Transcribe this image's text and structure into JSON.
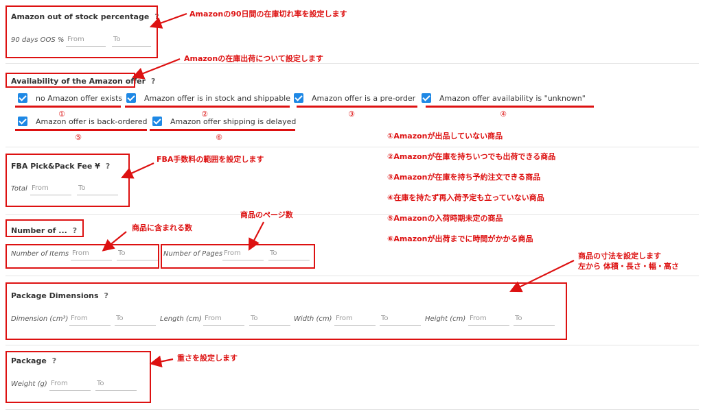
{
  "oos": {
    "title": "Amazon out of stock percentage",
    "help": "?",
    "label": "90 days OOS %",
    "from_placeholder": "From",
    "to_placeholder": "To"
  },
  "availability": {
    "title": "Availability of the Amazon offer",
    "help": "?",
    "options": [
      {
        "label": "no Amazon offer exists",
        "checked": true,
        "num": "①"
      },
      {
        "label": "Amazon offer is in stock and shippable",
        "checked": true,
        "num": "②"
      },
      {
        "label": "Amazon offer is a pre-order",
        "checked": true,
        "num": "③"
      },
      {
        "label": "Amazon offer availability is \"unknown\"",
        "checked": true,
        "num": "④"
      },
      {
        "label": "Amazon offer is back-ordered",
        "checked": true,
        "num": "⑤"
      },
      {
        "label": "Amazon offer shipping is delayed",
        "checked": true,
        "num": "⑥"
      }
    ]
  },
  "fba": {
    "title": "FBA Pick&Pack Fee ¥",
    "help": "?",
    "label": "Total",
    "from_placeholder": "From",
    "to_placeholder": "To"
  },
  "number_of": {
    "title": "Number of ...",
    "help": "?",
    "items_label": "Number of Items",
    "pages_label": "Number of Pages",
    "from_placeholder": "From",
    "to_placeholder": "To"
  },
  "dimensions": {
    "title": "Package Dimensions",
    "help": "?",
    "fields": [
      {
        "label": "Dimension (cm³)"
      },
      {
        "label": "Length (cm)"
      },
      {
        "label": "Width (cm)"
      },
      {
        "label": "Height (cm)"
      }
    ],
    "from_placeholder": "From",
    "to_placeholder": "To"
  },
  "package": {
    "title": "Package",
    "help": "?",
    "label": "Weight (g)",
    "from_placeholder": "From",
    "to_placeholder": "To"
  },
  "annotations": {
    "oos": "Amazonの90日間の在庫切れ率を設定します",
    "availability": "Amazonの在庫出荷について設定します",
    "fba": "FBA手数料の範囲を設定します",
    "items": "商品に含まれる数",
    "pages": "商品のページ数",
    "dims_line1": "商品の寸法を設定します",
    "dims_line2": "左から 体積・長さ・幅・高さ",
    "weight": "重さを設定します"
  },
  "notes": [
    "①Amazonが出品していない商品",
    "②Amazonが在庫を持ちいつでも出荷できる商品",
    "③Amazonが在庫を持ち予約注文できる商品",
    "④在庫を持たず再入荷予定も立っていない商品",
    "⑤Amazonの入荷時期未定の商品",
    "⑥Amazonが出荷までに時間がかかる商品"
  ],
  "colors": {
    "annotation_red": "#dd1111",
    "checkbox_blue": "#1e88e5"
  }
}
